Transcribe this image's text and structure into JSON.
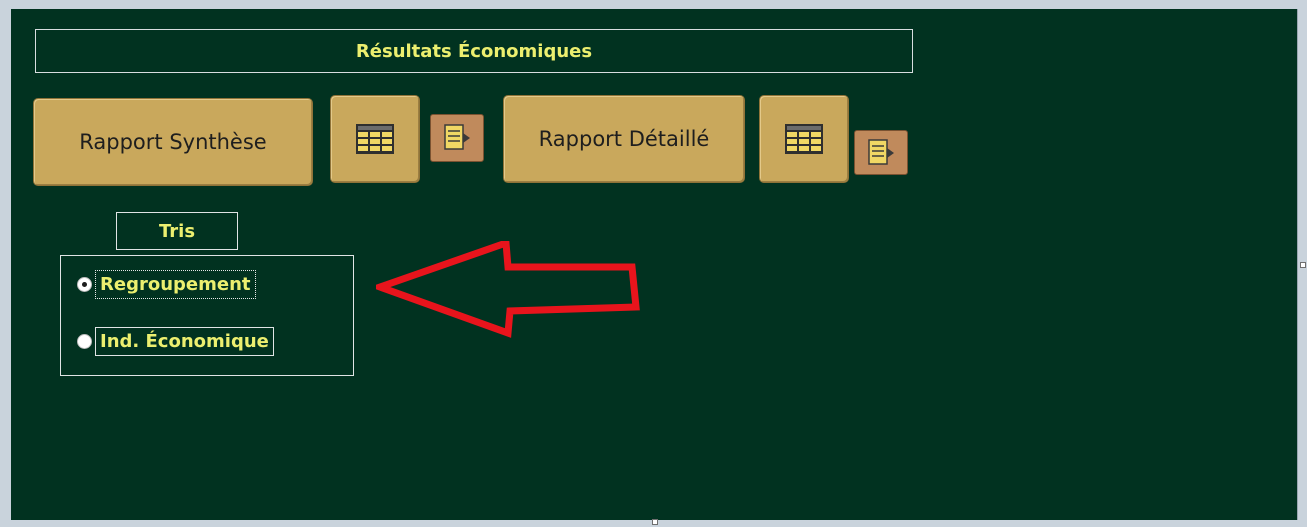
{
  "form": {
    "title": "Résultats Économiques",
    "buttons": {
      "rapport_synthese": "Rapport Synthèse",
      "rapport_detaille": "Rapport Détaillé"
    },
    "icons": {
      "synthese_preview": "datasheet-icon",
      "synthese_export": "export-report-icon",
      "detaille_preview": "datasheet-icon",
      "detaille_export": "export-report-icon"
    },
    "sort": {
      "label": "Tris",
      "options": [
        {
          "label": "Regroupement",
          "selected": true
        },
        {
          "label": "Ind. Économique",
          "selected": false
        }
      ]
    }
  },
  "annotation": {
    "arrow_color": "#e8141c"
  },
  "colors": {
    "form_bg": "#013220",
    "button_bg": "#c9a85c",
    "label_text": "#ecef6f"
  }
}
